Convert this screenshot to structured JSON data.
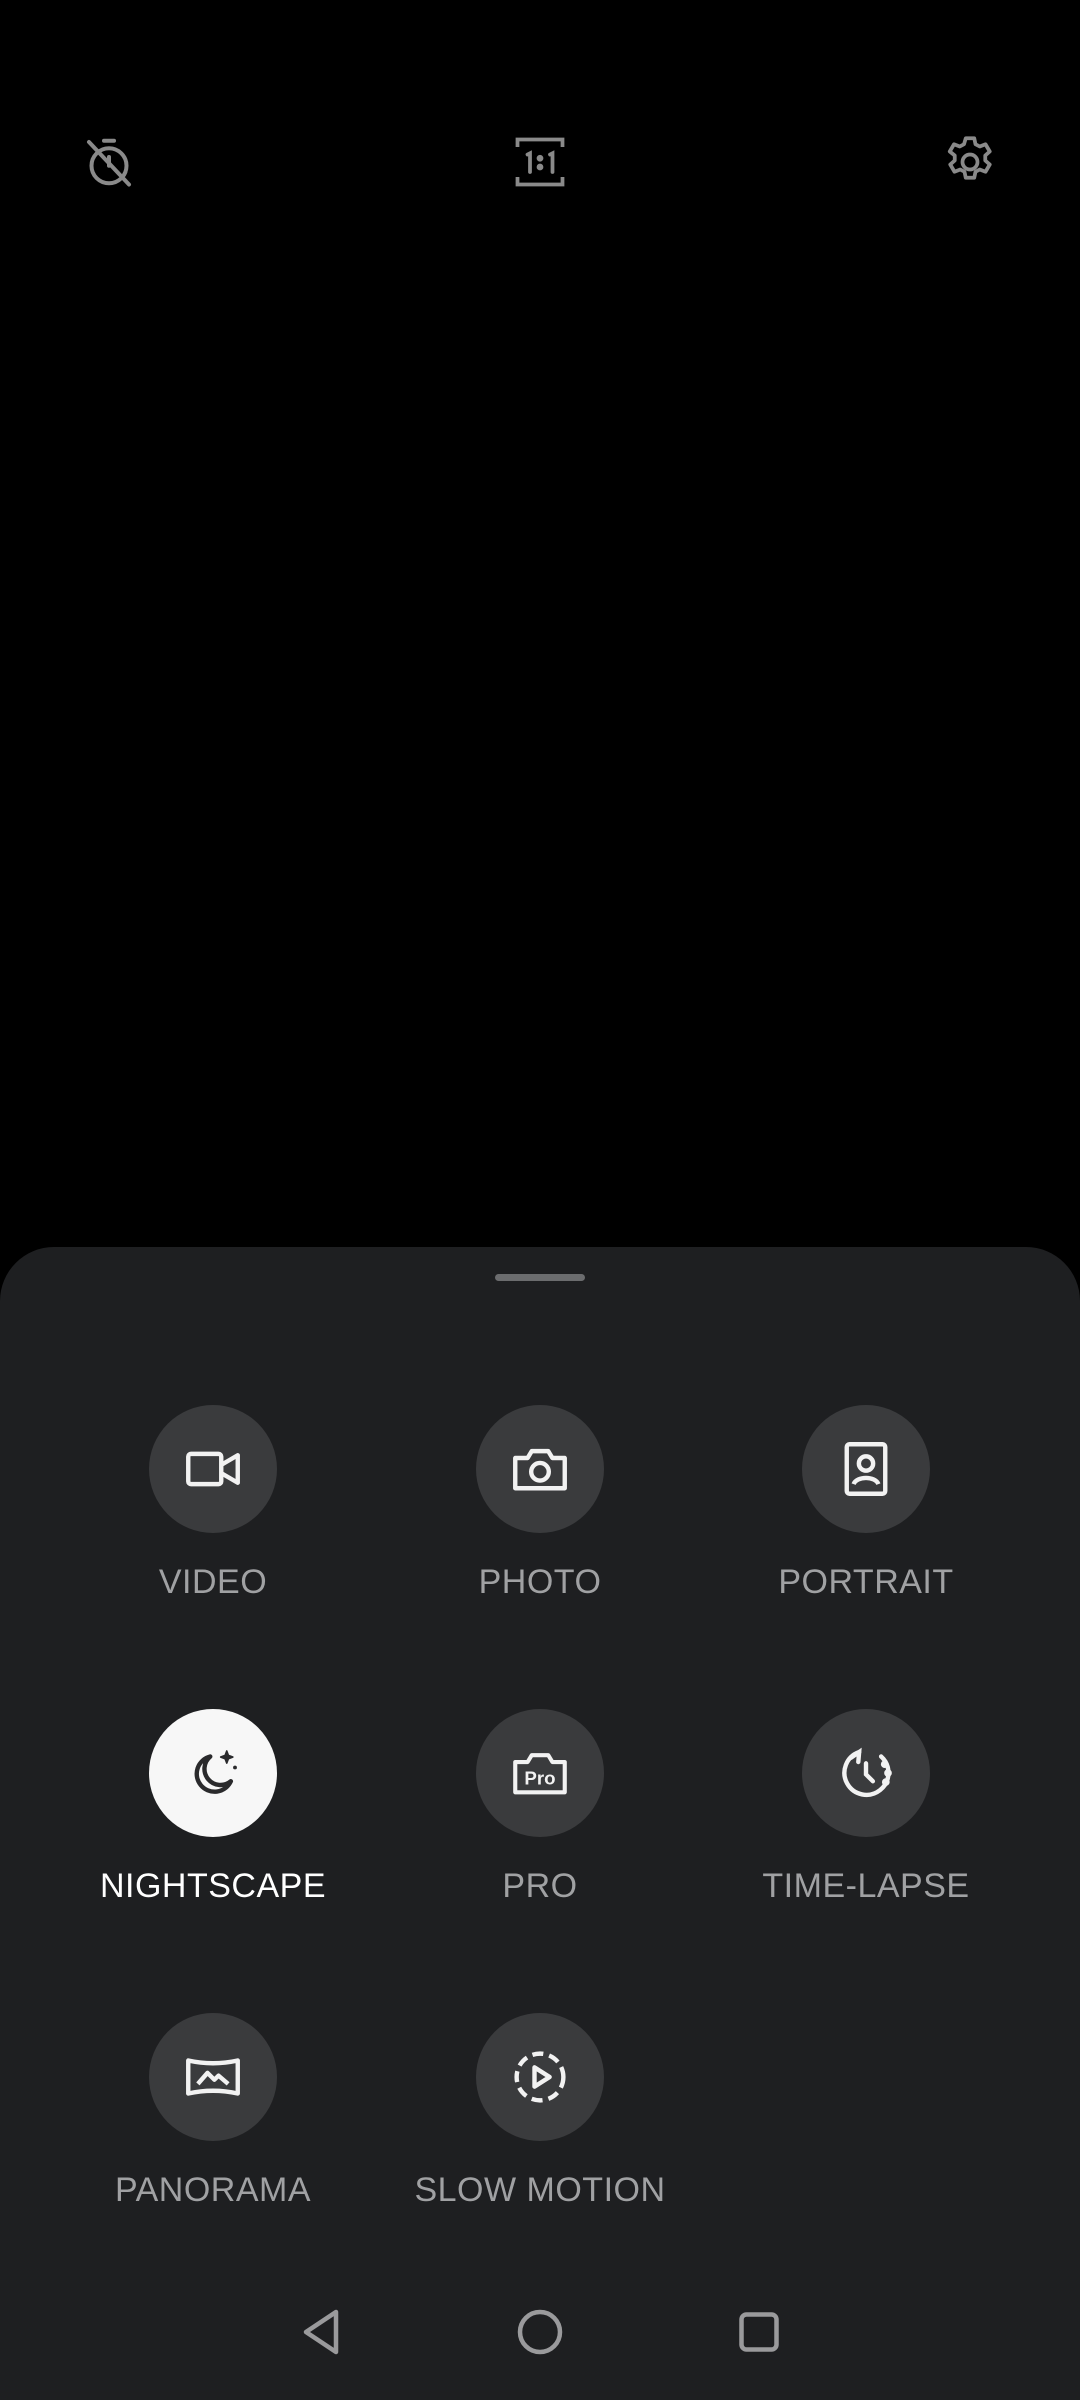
{
  "top_bar": {
    "timer_icon": "timer-off-icon",
    "ratio_icon": "aspect-ratio-1-1-icon",
    "settings_icon": "gear-icon"
  },
  "modes": [
    {
      "label": "VIDEO",
      "icon": "video-camera-icon",
      "selected": false
    },
    {
      "label": "PHOTO",
      "icon": "camera-icon",
      "selected": false
    },
    {
      "label": "PORTRAIT",
      "icon": "portrait-icon",
      "selected": false
    },
    {
      "label": "NIGHTSCAPE",
      "icon": "moon-stars-icon",
      "selected": true
    },
    {
      "label": "PRO",
      "icon": "pro-camera-icon",
      "selected": false
    },
    {
      "label": "TIME-LAPSE",
      "icon": "time-lapse-icon",
      "selected": false
    },
    {
      "label": "PANORAMA",
      "icon": "panorama-icon",
      "selected": false
    },
    {
      "label": "SLOW MOTION",
      "icon": "slow-motion-icon",
      "selected": false
    }
  ],
  "nav": {
    "back_icon": "back-triangle-icon",
    "home_icon": "home-circle-icon",
    "recents_icon": "recents-square-icon"
  },
  "colors": {
    "background": "#000000",
    "sheet": "#1e1f21",
    "circle": "#3a3b3d",
    "selected_circle": "#f7f7f7",
    "label": "#a0a1a3",
    "selected_label": "#ffffff"
  }
}
